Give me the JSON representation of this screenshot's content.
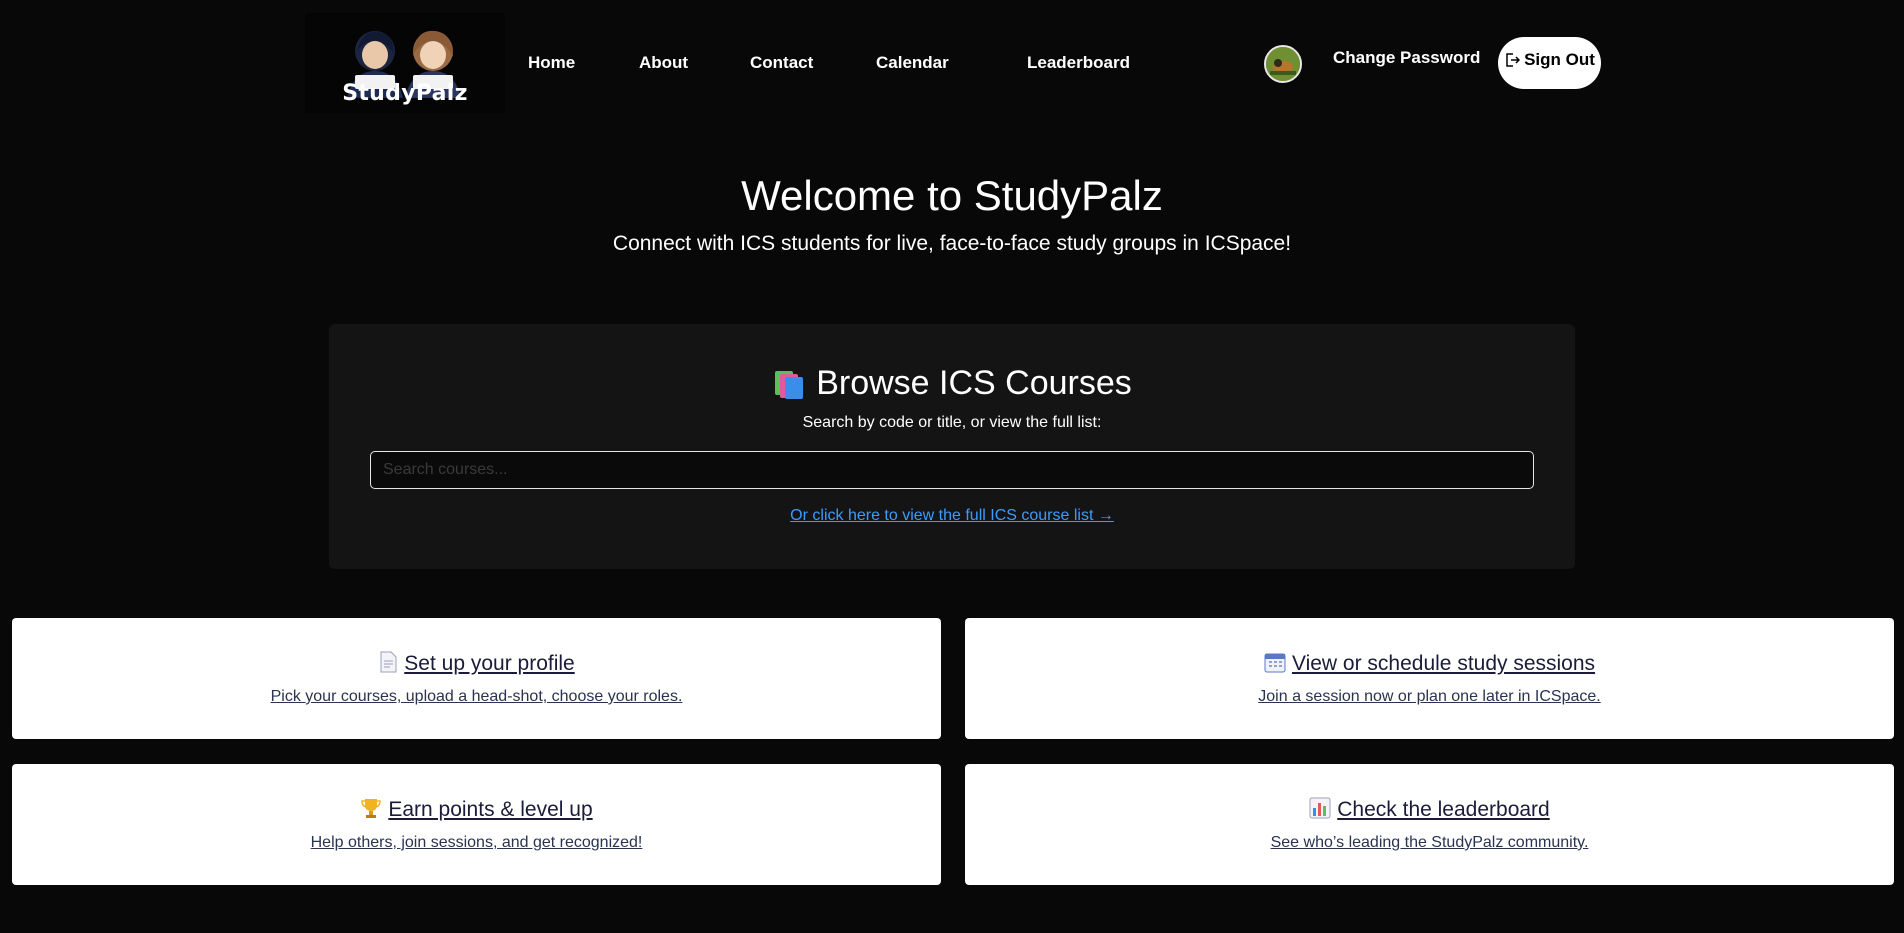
{
  "nav": {
    "logo_text": "StudyPalz",
    "links": [
      "Home",
      "About",
      "Contact",
      "Calendar",
      "Leaderboard"
    ],
    "change_password": "Change Password",
    "sign_out": "Sign Out"
  },
  "hero": {
    "title": "Welcome to StudyPalz",
    "subtitle": "Connect with ICS students for live, face-to-face study groups in ICSpace!"
  },
  "browse": {
    "title": "Browse ICS Courses",
    "subtitle": "Search by code or title, or view the full list:",
    "search_placeholder": "Search courses...",
    "search_value": "",
    "link": "Or click here to view the full ICS course list →"
  },
  "cards": [
    {
      "icon": "document-icon",
      "title": "Set up your profile",
      "desc": "Pick your courses, upload a head-shot, choose your roles."
    },
    {
      "icon": "calendar-icon",
      "title": "View or schedule study sessions",
      "desc": "Join a session now or plan one later in ICSpace."
    },
    {
      "icon": "trophy-icon",
      "title": "Earn points & level up",
      "desc": "Help others, join sessions, and get recognized!"
    },
    {
      "icon": "bar-chart-icon",
      "title": "Check the leaderboard",
      "desc": "See who’s leading the StudyPalz community."
    }
  ],
  "colors": {
    "background": "#080808",
    "panel": "#141414",
    "link": "#3b9bff",
    "card": "#ffffff"
  }
}
